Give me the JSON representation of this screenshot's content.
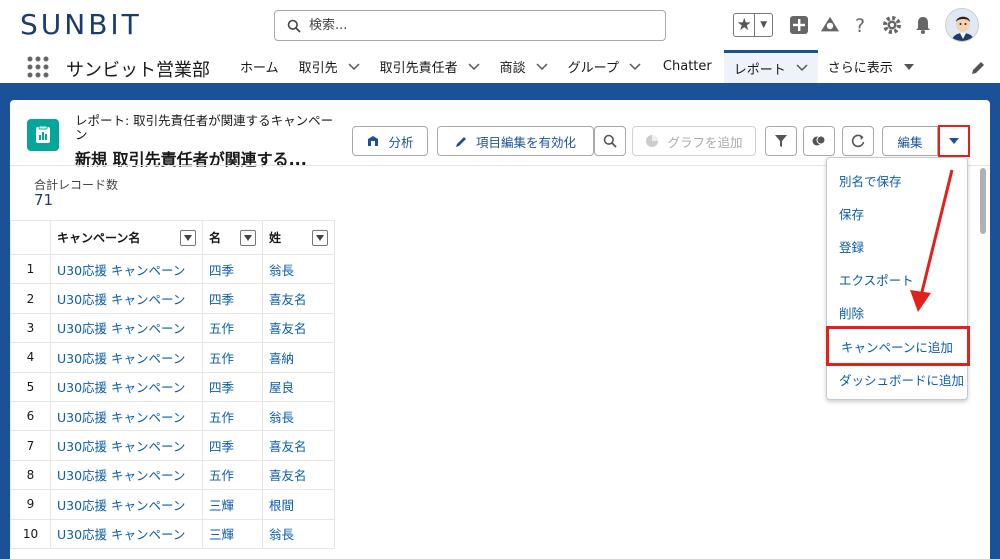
{
  "header": {
    "logo": "SUNBIT",
    "search_placeholder": "検索..."
  },
  "nav": {
    "app_name": "サンビット営業部",
    "tabs": [
      {
        "label": "ホーム",
        "has_menu": false
      },
      {
        "label": "取引先",
        "has_menu": true
      },
      {
        "label": "取引先責任者",
        "has_menu": true
      },
      {
        "label": "商談",
        "has_menu": true
      },
      {
        "label": "グループ",
        "has_menu": true
      },
      {
        "label": "Chatter",
        "has_menu": false
      },
      {
        "label": "レポート",
        "has_menu": true,
        "active": true
      },
      {
        "label": "さらに表示",
        "has_menu": true
      }
    ]
  },
  "report": {
    "subtitle": "レポート: 取引先責任者が関連するキャンペーン",
    "title": "新規 取引先責任者が関連する...",
    "buttons": {
      "analyze": "分析",
      "enable_edit": "項目編集を有効化",
      "add_chart": "グラフを追加",
      "edit": "編集"
    },
    "record_count_label": "合計レコード数",
    "record_count": "71"
  },
  "table": {
    "columns": [
      "キャンペーン名",
      "名",
      "姓"
    ],
    "rows": [
      {
        "num": "1",
        "campaign": "U30応援 キャンペーン",
        "first": "四季",
        "last": "翁長"
      },
      {
        "num": "2",
        "campaign": "U30応援 キャンペーン",
        "first": "四季",
        "last": "喜友名"
      },
      {
        "num": "3",
        "campaign": "U30応援 キャンペーン",
        "first": "五作",
        "last": "喜友名"
      },
      {
        "num": "4",
        "campaign": "U30応援 キャンペーン",
        "first": "五作",
        "last": "喜納"
      },
      {
        "num": "5",
        "campaign": "U30応援 キャンペーン",
        "first": "四季",
        "last": "屋良"
      },
      {
        "num": "6",
        "campaign": "U30応援 キャンペーン",
        "first": "五作",
        "last": "翁長"
      },
      {
        "num": "7",
        "campaign": "U30応援 キャンペーン",
        "first": "四季",
        "last": "喜友名"
      },
      {
        "num": "8",
        "campaign": "U30応援 キャンペーン",
        "first": "五作",
        "last": "喜友名"
      },
      {
        "num": "9",
        "campaign": "U30応援 キャンペーン",
        "first": "三輝",
        "last": "根間"
      },
      {
        "num": "10",
        "campaign": "U30応援 キャンペーン",
        "first": "三輝",
        "last": "翁長"
      }
    ]
  },
  "menu": {
    "items": [
      "別名で保存",
      "保存",
      "登録",
      "エクスポート",
      "削除",
      "キャンペーンに追加",
      "ダッシュボードに追加"
    ],
    "highlighted": "キャンペーンに追加"
  },
  "colors": {
    "brand": "#1b5297",
    "link": "#0b5cab",
    "highlight": "#e3211c",
    "report_icon": "#06a59a"
  }
}
